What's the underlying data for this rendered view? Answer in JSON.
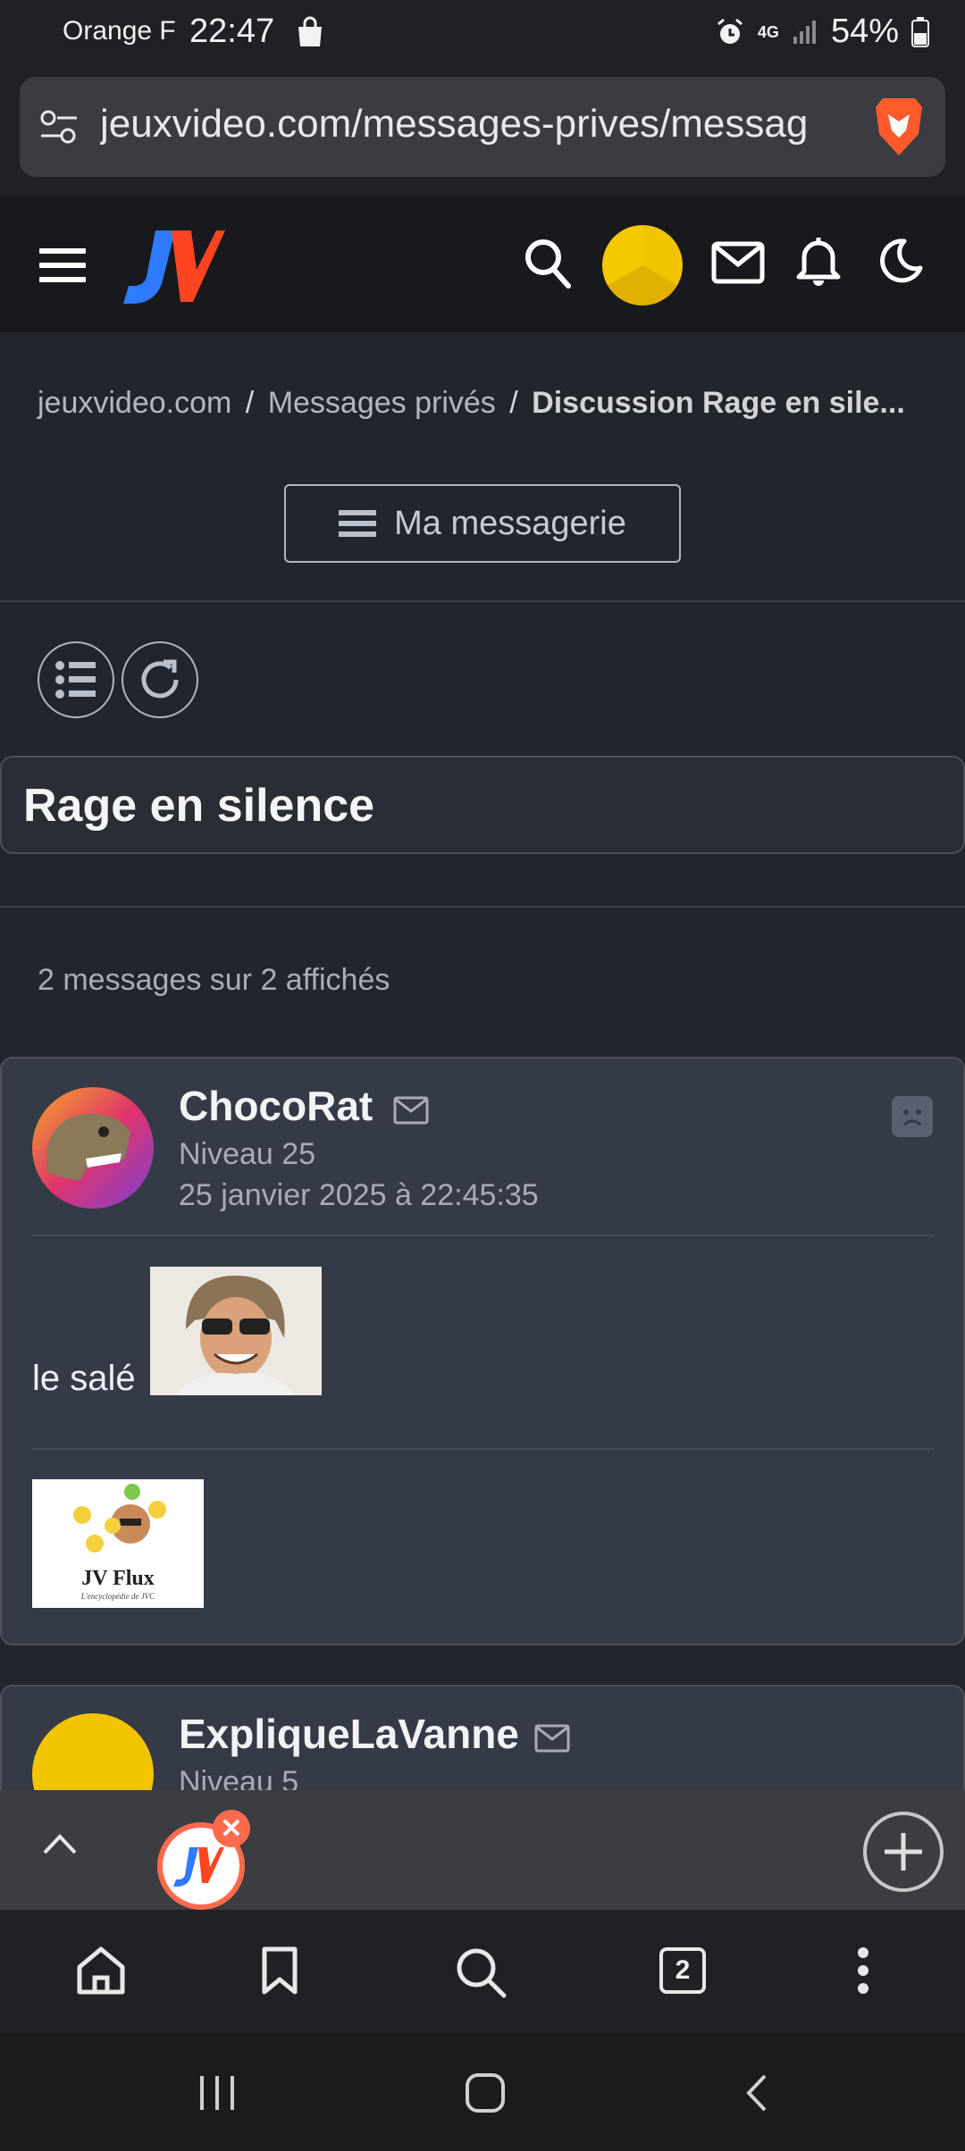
{
  "status_bar": {
    "carrier": "Orange F",
    "time": "22:47",
    "network": "4G",
    "battery": "54%"
  },
  "browser": {
    "url": "jeuxvideo.com/messages-prives/messag",
    "open_tabs": "2"
  },
  "breadcrumb": {
    "home": "jeuxvideo.com",
    "sep1": "/",
    "section": "Messages privés",
    "sep2": "/",
    "current": "Discussion Rage en sile..."
  },
  "messagerie_button": "Ma messagerie",
  "topic": {
    "title": "Rage en silence",
    "count_text": "2 messages sur 2 affichés"
  },
  "messages": [
    {
      "author": "ChocoRat",
      "level": "Niveau 25",
      "date": "25 janvier 2025 à 22:45:35",
      "text": "le salé",
      "signature_caption": "JV Flux",
      "signature_sub": "L'encyclopédie de JVC"
    },
    {
      "author": "ExpliqueLaVanne",
      "level": "Niveau 5"
    }
  ],
  "colors": {
    "accent_logo_blue": "#2f7bff",
    "accent_logo_red": "#ff4422",
    "brave_orange": "#ff5a2c",
    "tab_ring": "#ff6a4d"
  }
}
